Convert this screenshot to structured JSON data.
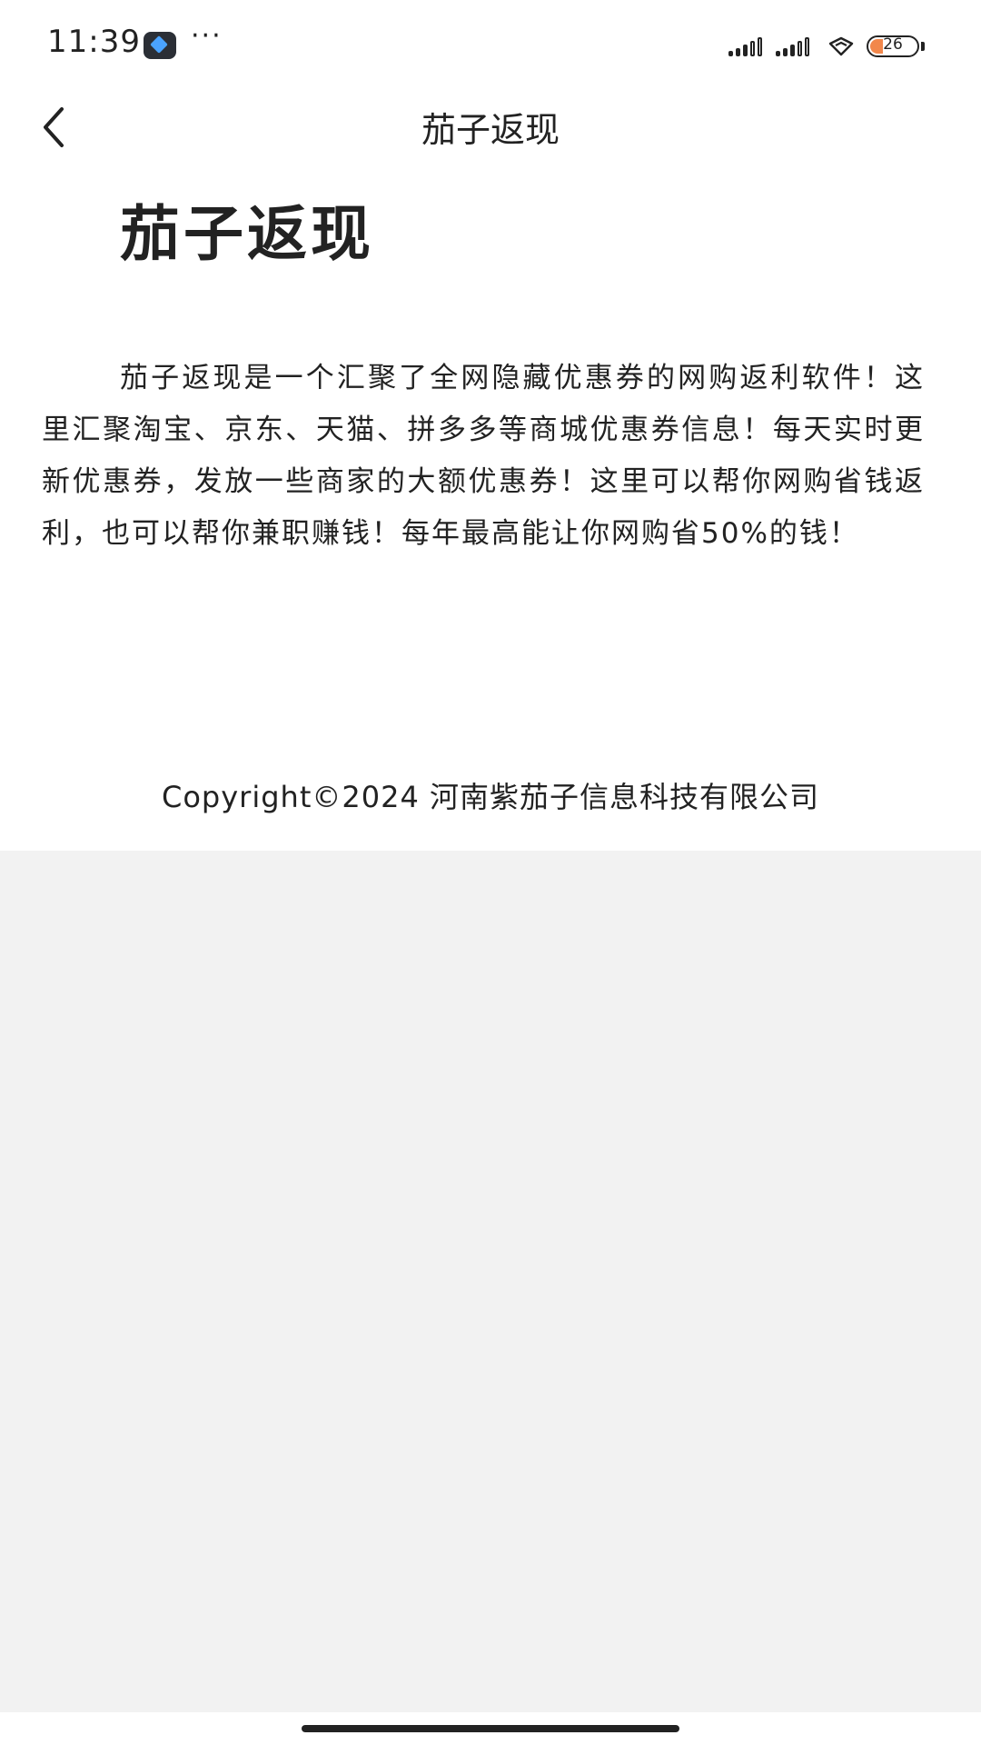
{
  "status_bar": {
    "time": "11:39",
    "more": "···",
    "battery_level": "26",
    "icons": [
      "app-notification-icon",
      "signal-icon",
      "signal-icon",
      "wifi-icon",
      "battery-icon"
    ]
  },
  "nav": {
    "title": "茄子返现",
    "back_icon": "chevron-left-icon"
  },
  "content": {
    "heading": "茄子返现",
    "description": "茄子返现是一个汇聚了全网隐藏优惠券的网购返利软件！这里汇聚淘宝、京东、天猫、拼多多等商城优惠券信息！每天实时更新优惠券，发放一些商家的大额优惠券！这里可以帮你网购省钱返利，也可以帮你兼职赚钱！每年最高能让你网购省50%的钱！",
    "copyright": "Copyright©2024 河南紫茄子信息科技有限公司"
  },
  "colors": {
    "text": "#222222",
    "background": "#ffffff",
    "empty_area": "#f2f2f2",
    "battery_accent": "#f2874b"
  }
}
